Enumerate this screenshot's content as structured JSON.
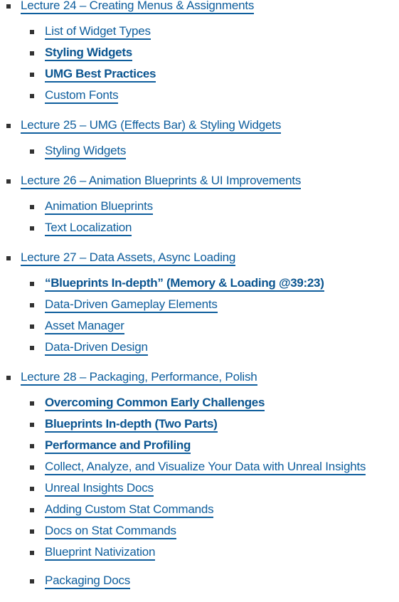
{
  "colors": {
    "link": "#0e5e9d",
    "bullet": "#333333",
    "background": "#ffffff"
  },
  "lectures": [
    {
      "title": "Lecture 24 – Creating Menus & Assignments",
      "items": [
        {
          "label": "List of Widget Types",
          "bold": false
        },
        {
          "label": "Styling Widgets",
          "bold": true
        },
        {
          "label": "UMG Best Practices",
          "bold": true
        },
        {
          "label": "Custom Fonts",
          "bold": false
        }
      ]
    },
    {
      "title": "Lecture 25 – UMG (Effects Bar) & Styling Widgets",
      "items": [
        {
          "label": "Styling Widgets",
          "bold": false
        }
      ]
    },
    {
      "title": "Lecture 26 – Animation Blueprints & UI Improvements",
      "items": [
        {
          "label": "Animation Blueprints",
          "bold": false
        },
        {
          "label": "Text Localization",
          "bold": false
        }
      ]
    },
    {
      "title": "Lecture 27 – Data Assets, Async Loading",
      "items": [
        {
          "label": "“Blueprints In-depth” (Memory & Loading @39:23)",
          "bold": true
        },
        {
          "label": "Data-Driven Gameplay Elements",
          "bold": false
        },
        {
          "label": "Asset Manager",
          "bold": false
        },
        {
          "label": "Data-Driven Design",
          "bold": false
        }
      ]
    },
    {
      "title": "Lecture 28 – Packaging, Performance, Polish",
      "items": [
        {
          "label": "Overcoming Common Early Challenges",
          "bold": true
        },
        {
          "label": "Blueprints In-depth (Two Parts)",
          "bold": true
        },
        {
          "label": "Performance and Profiling",
          "bold": true
        },
        {
          "label": "Collect, Analyze, and Visualize Your Data with Unreal Insights",
          "bold": false
        },
        {
          "label": "Unreal Insights Docs",
          "bold": false
        },
        {
          "label": "Adding Custom Stat Commands",
          "bold": false
        },
        {
          "label": "Docs on Stat Commands",
          "bold": false
        },
        {
          "label": "Blueprint Nativization",
          "bold": false
        },
        {
          "label": "Packaging Docs",
          "bold": false
        }
      ]
    }
  ]
}
